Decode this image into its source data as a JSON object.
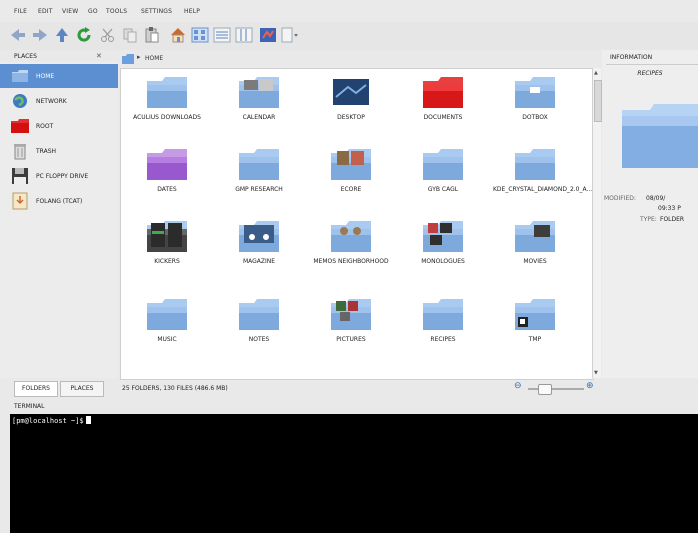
{
  "menu": [
    "File",
    "Edit",
    "View",
    "Go",
    "Tools",
    "Settings",
    "Help"
  ],
  "sidebar": {
    "header": "Places",
    "items": [
      {
        "label": "Home",
        "icon": "home-folder-icon",
        "selected": true
      },
      {
        "label": "Network",
        "icon": "network-icon"
      },
      {
        "label": "Root",
        "icon": "root-folder-icon"
      },
      {
        "label": "Trash",
        "icon": "trash-icon"
      },
      {
        "label": "PC Floppy Drive",
        "icon": "floppy-icon"
      },
      {
        "label": "Folang (tcat)",
        "icon": "drive-icon"
      }
    ],
    "tabs": [
      "Folders",
      "Places"
    ]
  },
  "path": {
    "location": "Home"
  },
  "files": [
    {
      "label": "Aculius Downloads",
      "kind": "folder"
    },
    {
      "label": "Calendar",
      "kind": "calendar"
    },
    {
      "label": "Desktop",
      "kind": "desktop"
    },
    {
      "label": "Documents",
      "kind": "red"
    },
    {
      "label": "Dotbox",
      "kind": "dot"
    },
    {
      "label": "Dates",
      "kind": "purple"
    },
    {
      "label": "Gmp Research",
      "kind": "folder"
    },
    {
      "label": "Ecore",
      "kind": "photo"
    },
    {
      "label": "Gyb Cagl",
      "kind": "folder"
    },
    {
      "label": "KDE_Crystal_Diamond_2.0_A...",
      "kind": "folder"
    },
    {
      "label": "Kickers",
      "kind": "media"
    },
    {
      "label": "Magazine",
      "kind": "media2"
    },
    {
      "label": "Memos Neighborhood",
      "kind": "people"
    },
    {
      "label": "Monologues",
      "kind": "media3"
    },
    {
      "label": "Movies",
      "kind": "film"
    },
    {
      "label": "Music",
      "kind": "folder"
    },
    {
      "label": "Notes",
      "kind": "folder"
    },
    {
      "label": "Pictures",
      "kind": "photo2"
    },
    {
      "label": "Recipes",
      "kind": "folder"
    },
    {
      "label": "Tmp",
      "kind": "tmp"
    }
  ],
  "status": "25 Folders, 130 Files (486.6 MB)",
  "info": {
    "header": "Information",
    "name": "Recipes",
    "modified_label": "Modified:",
    "modified_value": "08/09/",
    "modified_time": "09:33 P",
    "type_label": "Type:",
    "type_value": "Folder"
  },
  "terminal": {
    "header": "Terminal",
    "prompt": "[pm@localhost ~]$"
  }
}
